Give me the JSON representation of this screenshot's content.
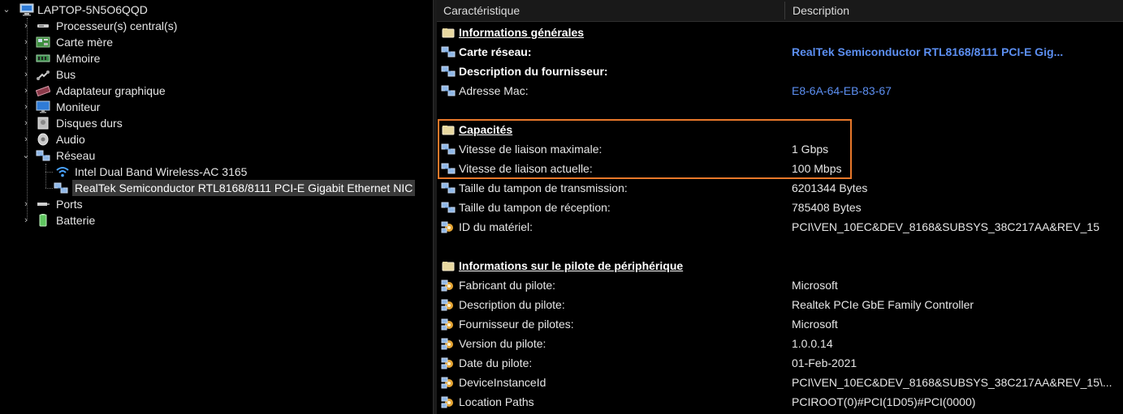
{
  "tree": {
    "root": {
      "label": "LAPTOP-5N5O6QQD",
      "icon": "computer-icon"
    },
    "items": [
      {
        "label": "Processeur(s) central(s)",
        "icon": "cpu-icon"
      },
      {
        "label": "Carte mère",
        "icon": "motherboard-icon"
      },
      {
        "label": "Mémoire",
        "icon": "memory-icon"
      },
      {
        "label": "Bus",
        "icon": "bus-icon"
      },
      {
        "label": "Adaptateur graphique",
        "icon": "graphics-card-icon"
      },
      {
        "label": "Moniteur",
        "icon": "monitor-icon"
      },
      {
        "label": "Disques durs",
        "icon": "hard-disk-icon"
      },
      {
        "label": "Audio",
        "icon": "speaker-icon"
      },
      {
        "label": "Réseau",
        "icon": "network-icon"
      },
      {
        "label": "Ports",
        "icon": "port-icon"
      },
      {
        "label": "Batterie",
        "icon": "battery-icon"
      }
    ],
    "network_children": [
      {
        "label": "Intel Dual Band Wireless-AC 3165",
        "icon": "wifi-icon"
      },
      {
        "label": "RealTek Semiconductor RTL8168/8111 PCI-E Gigabit Ethernet NIC",
        "icon": "network-adapter-icon"
      }
    ]
  },
  "list": {
    "columns": [
      "Caractéristique",
      "Description"
    ],
    "rows": [
      {
        "key": "Informations générales",
        "value": "",
        "style": "sect",
        "icon": "folder-icon"
      },
      {
        "key": "Carte réseau:",
        "value": "RealTek Semiconductor RTL8168/8111 PCI-E Gig...",
        "style": "bold",
        "vstyle": "linkb",
        "icon": "network-icon"
      },
      {
        "key": "Description du fournisseur:",
        "value": "",
        "style": "bold",
        "icon": "network-icon"
      },
      {
        "key": "Adresse Mac:",
        "value": "E8-6A-64-EB-83-67",
        "style": "",
        "vstyle": "link",
        "icon": "network-icon"
      },
      {
        "key": "",
        "value": "",
        "style": "blank"
      },
      {
        "key": "Capacités",
        "value": "",
        "style": "sect",
        "icon": "folder-icon"
      },
      {
        "key": "Vitesse de liaison maximale:",
        "value": "1 Gbps",
        "style": "",
        "icon": "network-icon"
      },
      {
        "key": "Vitesse de liaison actuelle:",
        "value": "100 Mbps",
        "style": "",
        "icon": "network-icon"
      },
      {
        "key": "Taille du tampon de transmission:",
        "value": "6201344 Bytes",
        "style": "",
        "icon": "network-icon"
      },
      {
        "key": "Taille du tampon de réception:",
        "value": "785408 Bytes",
        "style": "",
        "icon": "network-icon"
      },
      {
        "key": "ID du matériel:",
        "value": "PCI\\VEN_10EC&DEV_8168&SUBSYS_38C217AA&REV_15",
        "style": "",
        "icon": "gear-icon"
      },
      {
        "key": "",
        "value": "",
        "style": "blank"
      },
      {
        "key": "Informations sur le pilote de périphérique",
        "value": "",
        "style": "sect",
        "icon": "folder-icon"
      },
      {
        "key": "Fabricant du pilote:",
        "value": "Microsoft",
        "style": "",
        "icon": "gear-icon"
      },
      {
        "key": "Description du pilote:",
        "value": "Realtek PCIe GbE Family Controller",
        "style": "",
        "icon": "gear-icon"
      },
      {
        "key": "Fournisseur de pilotes:",
        "value": "Microsoft",
        "style": "",
        "icon": "gear-icon"
      },
      {
        "key": "Version du pilote:",
        "value": "1.0.0.14",
        "style": "",
        "icon": "gear-icon"
      },
      {
        "key": "Date du pilote:",
        "value": "01-Feb-2021",
        "style": "",
        "icon": "gear-icon"
      },
      {
        "key": "DeviceInstanceId",
        "value": "PCI\\VEN_10EC&DEV_8168&SUBSYS_38C217AA&REV_15\\...",
        "style": "",
        "icon": "gear-icon"
      },
      {
        "key": "Location Paths",
        "value": "PCIROOT(0)#PCI(1D05)#PCI(0000)",
        "style": "",
        "icon": "gear-icon"
      }
    ]
  },
  "colors": {
    "highlight": "#e8782a",
    "link": "#5c8ff2",
    "background": "#000000"
  }
}
